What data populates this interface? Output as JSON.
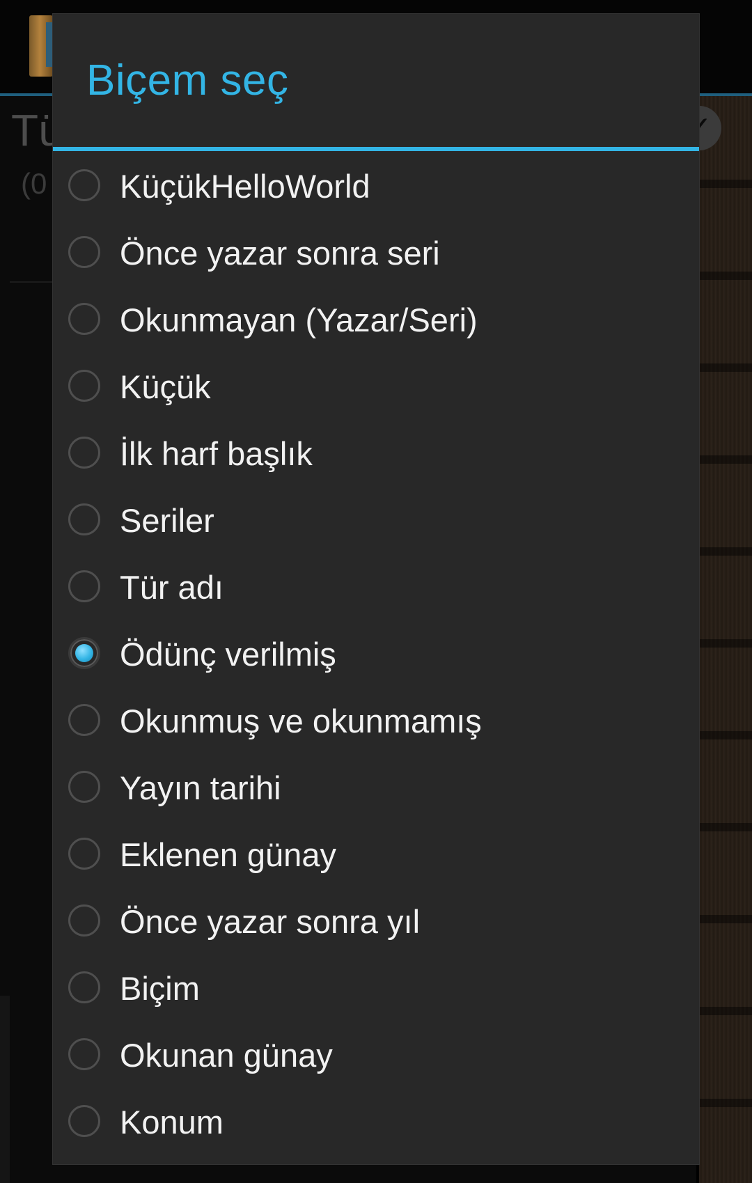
{
  "background": {
    "title_partial": "Tü",
    "subtitle_partial": "(0"
  },
  "dialog": {
    "title": "Biçem seç",
    "accent_color": "#33b5e5",
    "options": [
      {
        "label": "KüçükHelloWorld",
        "selected": false
      },
      {
        "label": "Önce yazar sonra seri",
        "selected": false
      },
      {
        "label": "Okunmayan (Yazar/Seri)",
        "selected": false
      },
      {
        "label": "Küçük",
        "selected": false
      },
      {
        "label": "İlk harf başlık",
        "selected": false
      },
      {
        "label": "Seriler",
        "selected": false
      },
      {
        "label": "Tür adı",
        "selected": false
      },
      {
        "label": "Ödünç verilmiş",
        "selected": true
      },
      {
        "label": "Okunmuş ve okunmamış",
        "selected": false
      },
      {
        "label": "Yayın tarihi",
        "selected": false
      },
      {
        "label": "Eklenen günay",
        "selected": false
      },
      {
        "label": "Önce yazar sonra yıl",
        "selected": false
      },
      {
        "label": "Biçim",
        "selected": false
      },
      {
        "label": "Okunan günay",
        "selected": false
      },
      {
        "label": "Konum",
        "selected": false
      }
    ]
  }
}
